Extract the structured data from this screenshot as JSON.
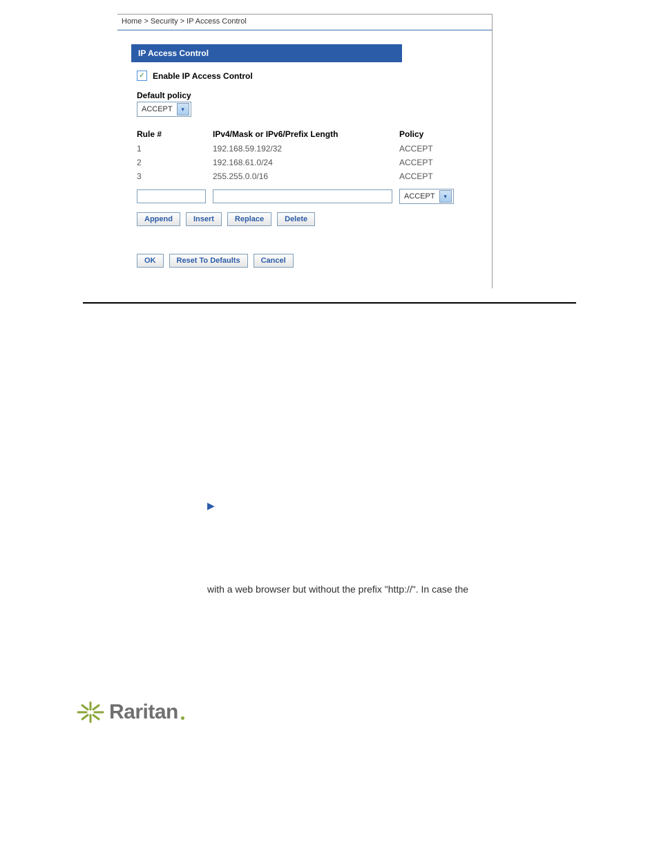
{
  "breadcrumb": "Home > Security > IP Access Control",
  "panel": {
    "title": "IP Access Control",
    "enable_label": "Enable IP Access Control",
    "enable_checked": true,
    "default_policy_label": "Default policy",
    "default_policy_value": "ACCEPT",
    "columns": {
      "rule": "Rule #",
      "ip": "IPv4/Mask or IPv6/Prefix Length",
      "policy": "Policy"
    },
    "rules": [
      {
        "num": "1",
        "ip": "192.168.59.192/32",
        "policy": "ACCEPT"
      },
      {
        "num": "2",
        "ip": "192.168.61.0/24",
        "policy": "ACCEPT"
      },
      {
        "num": "3",
        "ip": "255.255.0.0/16",
        "policy": "ACCEPT"
      }
    ],
    "new_rule_policy": "ACCEPT",
    "buttons": {
      "append": "Append",
      "insert": "Insert",
      "replace": "Replace",
      "delete": "Delete",
      "ok": "OK",
      "reset": "Reset To Defaults",
      "cancel": "Cancel"
    }
  },
  "doc": {
    "line1": "with a web browser but without the prefix \"http://\". In case the"
  },
  "logo_text": "Raritan"
}
